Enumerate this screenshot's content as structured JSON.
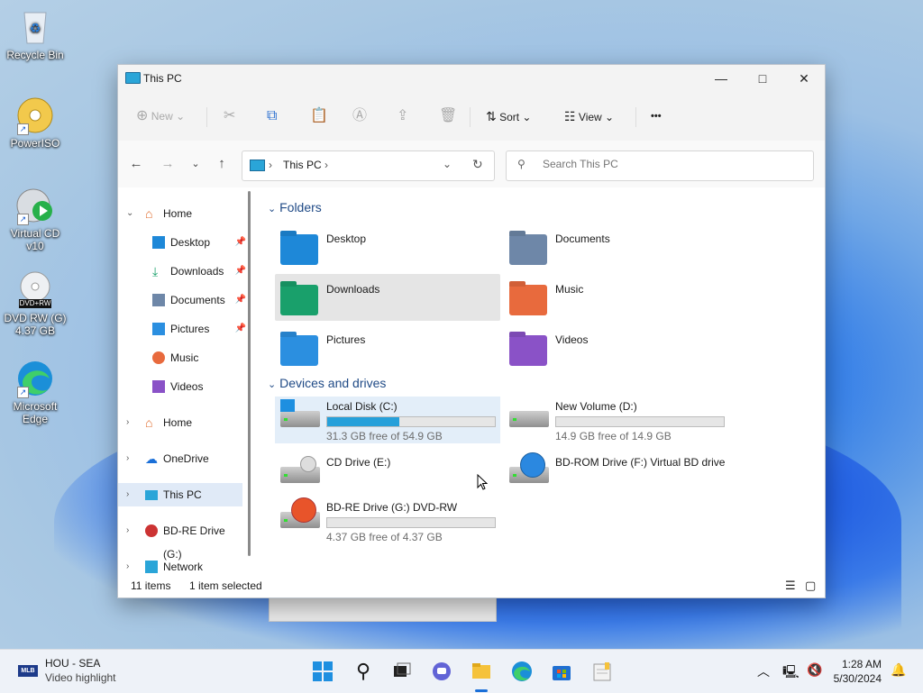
{
  "desktop": {
    "icons": [
      {
        "label": "Recycle Bin"
      },
      {
        "label": "PowerISO"
      },
      {
        "label": "Virtual CD v10"
      },
      {
        "label": "DVD RW (G)\n4.37 GB"
      },
      {
        "label": "Microsoft Edge"
      }
    ],
    "dvd_badge": "DVD+RW"
  },
  "window": {
    "title": "This PC",
    "toolbar": {
      "new": "New",
      "sort": "Sort",
      "view": "View",
      "more": "•••"
    },
    "address": {
      "path": "This PC"
    },
    "search": {
      "placeholder": "Search This PC"
    },
    "sidebar": {
      "items": [
        {
          "label": "Home"
        },
        {
          "label": "Desktop"
        },
        {
          "label": "Downloads"
        },
        {
          "label": "Documents"
        },
        {
          "label": "Pictures"
        },
        {
          "label": "Music"
        },
        {
          "label": "Videos"
        },
        {
          "label": "Home"
        },
        {
          "label": "OneDrive"
        },
        {
          "label": "This PC"
        },
        {
          "label": "BD-RE Drive (G:)"
        },
        {
          "label": "Network"
        }
      ]
    },
    "sections": {
      "folders": "Folders",
      "devices": "Devices and drives"
    },
    "folders": [
      {
        "label": "Desktop",
        "color": "#1e88d8"
      },
      {
        "label": "Documents",
        "color": "#6e87a8"
      },
      {
        "label": "Downloads",
        "color": "#19a06b"
      },
      {
        "label": "Music",
        "color": "#e86a3d"
      },
      {
        "label": "Pictures",
        "color": "#2b8fe0"
      },
      {
        "label": "Videos",
        "color": "#8a52c7"
      }
    ],
    "drives": [
      {
        "label": "Local Disk (C:)",
        "free": "31.3 GB free of 54.9 GB",
        "used_fraction": 0.43
      },
      {
        "label": "New Volume (D:)",
        "free": "14.9 GB free of 14.9 GB",
        "used_fraction": 0.0
      },
      {
        "label": "CD Drive (E:)"
      },
      {
        "label": "BD-ROM Drive (F:) Virtual BD drive"
      },
      {
        "label": "BD-RE Drive (G:) DVD-RW",
        "free": "4.37 GB free of 4.37 GB",
        "used_fraction": 0.0
      }
    ],
    "status": {
      "items": "11 items",
      "selected": "1 item selected"
    }
  },
  "taskbar": {
    "weather_title": "HOU - SEA",
    "weather_sub": "Video highlight",
    "mlb_badge": "MLB",
    "time": "1:28 AM",
    "date": "5/30/2024"
  }
}
